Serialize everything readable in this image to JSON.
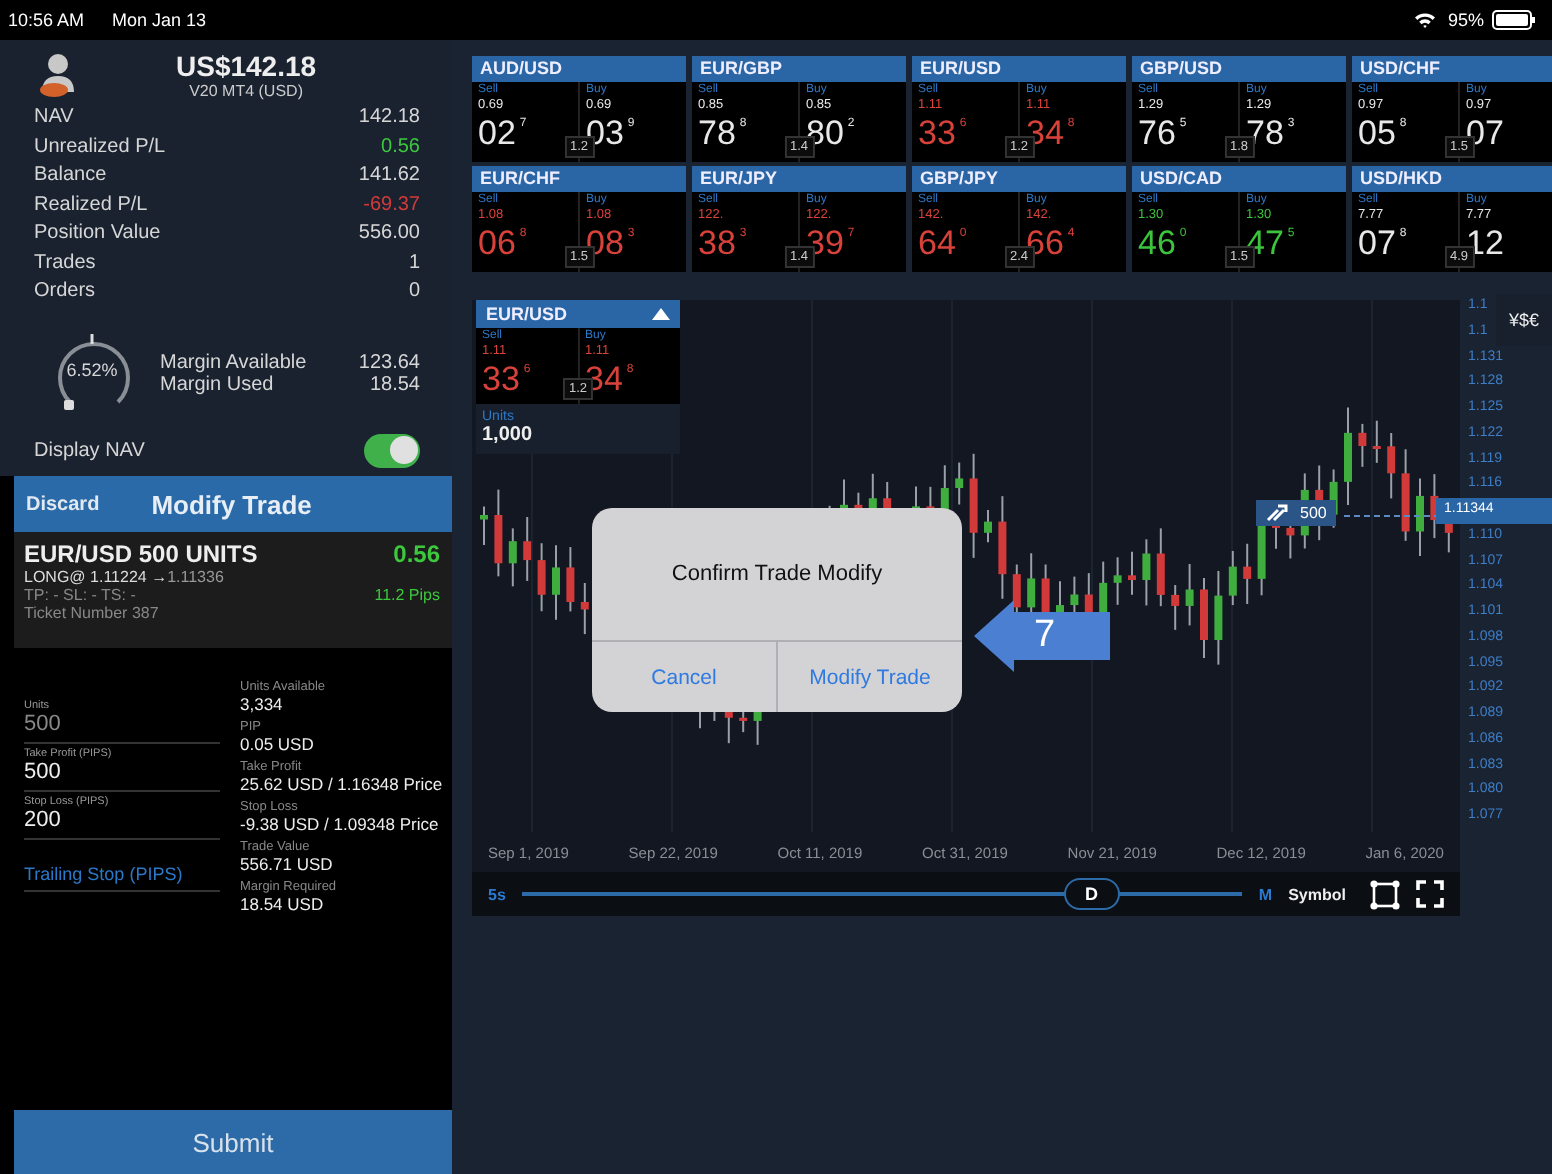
{
  "status_bar": {
    "time": "10:56 AM",
    "date": "Mon Jan 13",
    "battery": "95%"
  },
  "account": {
    "balance": "US$142.18",
    "name": "V20 MT4 (USD)",
    "rows": [
      {
        "label": "NAV",
        "value": "142.18",
        "color": "#d6d6d6"
      },
      {
        "label": "Unrealized P/L",
        "value": "0.56",
        "color": "#3cc83c"
      },
      {
        "label": "Balance",
        "value": "141.62",
        "color": "#d6d6d6"
      },
      {
        "label": "Realized P/L",
        "value": "-69.37",
        "color": "#d23a3a"
      },
      {
        "label": "Position Value",
        "value": "556.00",
        "color": "#d6d6d6"
      },
      {
        "label": "Trades",
        "value": "1",
        "color": "#d6d6d6"
      },
      {
        "label": "Orders",
        "value": "0",
        "color": "#d6d6d6"
      }
    ],
    "margin": {
      "percent": "6.52%",
      "rows": [
        {
          "label": "Margin Available",
          "value": "123.64"
        },
        {
          "label": "Margin Used",
          "value": "18.54"
        }
      ]
    },
    "display_nav": {
      "label": "Display NAV",
      "on": true
    }
  },
  "modify_trade": {
    "discard": "Discard",
    "title": "Modify Trade",
    "trade": {
      "pair_units": "EUR/USD  500 UNITS",
      "pl": "0.56",
      "entry": "LONG@ 1.11224 →",
      "current": "1.11336",
      "stops": "TP: -   SL: -   TS: -",
      "pips": "11.2 Pips",
      "ticket": "Ticket Number  387"
    },
    "fields": [
      {
        "kind": "input",
        "label": "Units",
        "placeholder": "500"
      },
      {
        "kind": "input",
        "label": "Take Profit (PIPS)",
        "value": "500"
      },
      {
        "kind": "input",
        "label": "Stop Loss (PIPS)",
        "value": "200"
      },
      {
        "kind": "link",
        "value": "Trailing Stop (PIPS)"
      }
    ],
    "info": [
      {
        "label": "Units Available",
        "value": "3,334"
      },
      {
        "label": "PIP",
        "value": "0.05 USD"
      },
      {
        "label": "Take Profit",
        "value": "25.62 USD / 1.16348 Price"
      },
      {
        "label": "Stop Loss",
        "value": "-9.38 USD / 1.09348 Price"
      },
      {
        "label": "Trade Value",
        "value": "556.71 USD"
      },
      {
        "label": "Margin Required",
        "value": "18.54 USD"
      }
    ],
    "submit": "Submit"
  },
  "quotes": [
    {
      "pair": "AUD/USD",
      "color": "#e8e8e8",
      "spread": "1.2",
      "sell": {
        "label": "Sell",
        "big": "0.69",
        "pips": "02",
        "fraction": "7"
      },
      "buy": {
        "label": "Buy",
        "big": "0.69",
        "pips": "03",
        "fraction": "9"
      }
    },
    {
      "pair": "EUR/GBP",
      "color": "#e8e8e8",
      "spread": "1.4",
      "sell": {
        "label": "Sell",
        "big": "0.85",
        "pips": "78",
        "fraction": "8"
      },
      "buy": {
        "label": "Buy",
        "big": "0.85",
        "pips": "80",
        "fraction": "2"
      }
    },
    {
      "pair": "EUR/USD",
      "color": "#d8423a",
      "spread": "1.2",
      "sell": {
        "label": "Sell",
        "big": "1.11",
        "pips": "33",
        "fraction": "6"
      },
      "buy": {
        "label": "Buy",
        "big": "1.11",
        "pips": "34",
        "fraction": "8"
      }
    },
    {
      "pair": "GBP/USD",
      "color": "#e8e8e8",
      "spread": "1.8",
      "sell": {
        "label": "Sell",
        "big": "1.29",
        "pips": "76",
        "fraction": "5"
      },
      "buy": {
        "label": "Buy",
        "big": "1.29",
        "pips": "78",
        "fraction": "3"
      }
    },
    {
      "pair": "USD/CHF",
      "color": "#e8e8e8",
      "spread": "1.5",
      "sell": {
        "label": "Sell",
        "big": "0.97",
        "pips": "05",
        "fraction": "8"
      },
      "buy": {
        "label": "Buy",
        "big": "0.97",
        "pips": "07"
      }
    },
    {
      "pair": "EUR/CHF",
      "color": "#d8423a",
      "spread": "1.5",
      "sell": {
        "label": "Sell",
        "big": "1.08",
        "pips": "06",
        "fraction": "8"
      },
      "buy": {
        "label": "Buy",
        "big": "1.08",
        "pips": "08",
        "fraction": "3"
      }
    },
    {
      "pair": "EUR/JPY",
      "color": "#d8423a",
      "spread": "1.4",
      "sell": {
        "label": "Sell",
        "big": "122.",
        "pips": "38",
        "fraction": "3"
      },
      "buy": {
        "label": "Buy",
        "big": "122.",
        "pips": "39",
        "fraction": "7"
      }
    },
    {
      "pair": "GBP/JPY",
      "color": "#d8423a",
      "spread": "2.4",
      "sell": {
        "label": "Sell",
        "big": "142.",
        "pips": "64",
        "fraction": "0"
      },
      "buy": {
        "label": "Buy",
        "big": "142.",
        "pips": "66",
        "fraction": "4"
      }
    },
    {
      "pair": "USD/CAD",
      "color": "#3cc43c",
      "spread": "1.5",
      "sell": {
        "label": "Sell",
        "big": "1.30",
        "pips": "46",
        "fraction": "0"
      },
      "buy": {
        "label": "Buy",
        "big": "1.30",
        "pips": "47",
        "fraction": "5"
      }
    },
    {
      "pair": "USD/HKD",
      "color": "#e8e8e8",
      "spread": "4.9",
      "sell": {
        "label": "Sell",
        "big": "7.77",
        "pips": "07",
        "fraction": "8"
      },
      "buy": {
        "label": "Buy",
        "big": "7.77",
        "pips": "12"
      }
    }
  ],
  "chart": {
    "currency_button": "¥$€",
    "widget": {
      "pair": "EUR/USD",
      "spread": "1.2",
      "color": "#d8423a",
      "sell": {
        "label": "Sell",
        "big": "1.11",
        "pips": "33",
        "fraction": "6"
      },
      "buy": {
        "label": "Buy",
        "big": "1.11",
        "pips": "34",
        "fraction": "8"
      },
      "units_label": "Units",
      "units": "1,000"
    },
    "price_axis": [
      {
        "kind": "label",
        "text": "1.1"
      },
      {
        "kind": "label",
        "text": "1.1"
      },
      {
        "kind": "label",
        "text": "1.131"
      },
      {
        "kind": "label",
        "text": "1.128"
      },
      {
        "kind": "label",
        "text": "1.125"
      },
      {
        "kind": "label",
        "text": "1.122"
      },
      {
        "kind": "label",
        "text": "1.119"
      },
      {
        "kind": "label",
        "text": "1.116"
      },
      {
        "kind": "current",
        "text": "1.11344"
      },
      {
        "kind": "label",
        "text": "1.110"
      },
      {
        "kind": "label",
        "text": "1.107"
      },
      {
        "kind": "label",
        "text": "1.104"
      },
      {
        "kind": "label",
        "text": "1.101"
      },
      {
        "kind": "label",
        "text": "1.098"
      },
      {
        "kind": "label",
        "text": "1.095"
      },
      {
        "kind": "label",
        "text": "1.092"
      },
      {
        "kind": "label",
        "text": "1.089"
      },
      {
        "kind": "label",
        "text": "1.086"
      },
      {
        "kind": "label",
        "text": "1.083"
      },
      {
        "kind": "label",
        "text": "1.080"
      },
      {
        "kind": "label",
        "text": "1.077"
      }
    ],
    "position_units": "500",
    "dates": [
      "Sep 1, 2019",
      "Sep 22, 2019",
      "Oct 11, 2019",
      "Oct 31, 2019",
      "Nov 21, 2019",
      "Dec 12, 2019",
      "Jan 6, 2020"
    ],
    "timeframe": {
      "min": "5s",
      "max": "M",
      "current": "D",
      "level": 0.79
    },
    "symbol": "Symbol",
    "dialog": {
      "title": "Confirm Trade Modify",
      "buttons": [
        "Cancel",
        "Modify Trade"
      ]
    },
    "callout": "7"
  }
}
